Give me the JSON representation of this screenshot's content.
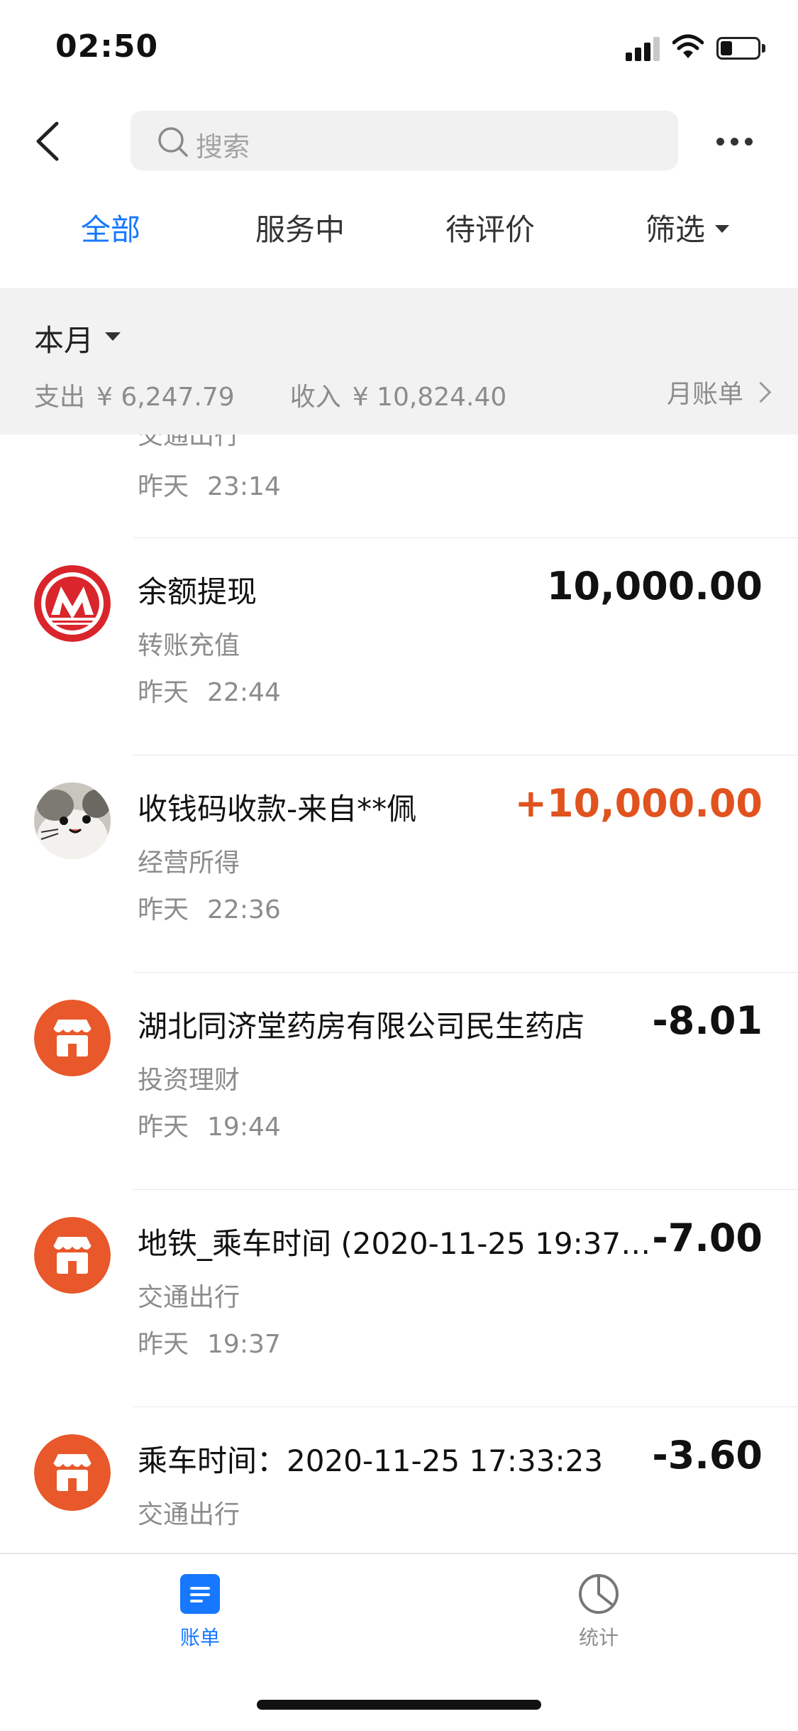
{
  "status_bar": {
    "time": "02:50"
  },
  "nav": {
    "search_placeholder": "搜索"
  },
  "tabs": [
    {
      "label": "全部",
      "active": true
    },
    {
      "label": "服务中",
      "active": false
    },
    {
      "label": "待评价",
      "active": false
    },
    {
      "label": "筛选",
      "active": false
    }
  ],
  "month": {
    "label": "本月",
    "expense_label": "支出",
    "expense_value": "¥ 6,247.79",
    "income_label": "收入",
    "income_value": "¥ 10,824.40",
    "monthly_bill": "月账单"
  },
  "partial_row": {
    "category": "交通出行",
    "day": "昨天",
    "time": "23:14"
  },
  "transactions": [
    {
      "title": "余额提现",
      "category": "转账充值",
      "day": "昨天",
      "time": "22:44",
      "amount": "10,000.00",
      "type": "neutral",
      "icon": "cmb-bank-logo"
    },
    {
      "title": "收钱码收款-来自**佩",
      "category": "经营所得",
      "day": "昨天",
      "time": "22:36",
      "amount": "+10,000.00",
      "type": "income",
      "icon": "cat-avatar"
    },
    {
      "title": "湖北同济堂药房有限公司民生药店",
      "category": "投资理财",
      "day": "昨天",
      "time": "19:44",
      "amount": "-8.01",
      "type": "expense",
      "icon": "store-icon"
    },
    {
      "title": "地铁_乘车时间 (2020-11-25 19:37:...",
      "category": "交通出行",
      "day": "昨天",
      "time": "19:37",
      "amount": "-7.00",
      "type": "expense",
      "icon": "store-icon"
    },
    {
      "title": "乘车时间：2020-11-25 17:33:23",
      "category": "交通出行",
      "day": "",
      "time": "",
      "amount": "-3.60",
      "type": "expense",
      "icon": "store-icon"
    }
  ],
  "tab_bar": {
    "bills_label": "账单",
    "stats_label": "统计"
  },
  "colors": {
    "accent": "#1677ff",
    "income": "#e0531f",
    "store_icon": "#e8582a",
    "bank_red": "#d9252b"
  }
}
